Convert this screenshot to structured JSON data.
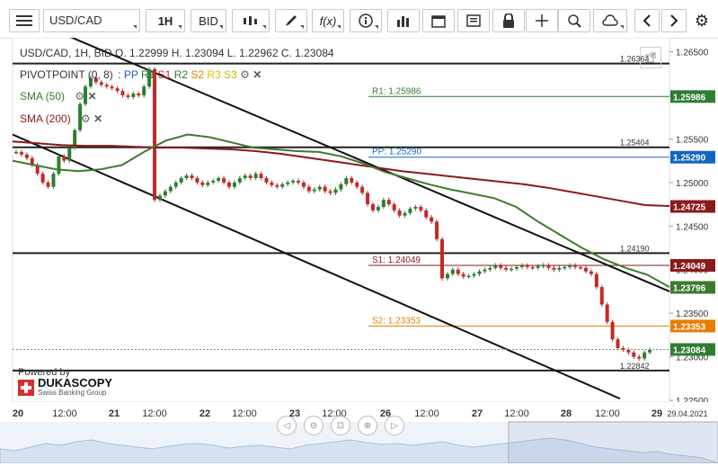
{
  "toolbar": {
    "symbol": "USD/CAD",
    "timeframe": "1H",
    "side": "BID",
    "fx_label": "f(x)"
  },
  "header": {
    "ohlc": "USD/CAD, 1H, BID   O. 1.22999 H. 1.23094 L. 1.22962 C. 1.23084",
    "pivot_label": "PIVOTPOINT (0, 8)",
    "pivot_levels": [
      "PP",
      "R1",
      "S1",
      "R2",
      "S2",
      "R3",
      "S3"
    ],
    "sma50": "SMA (50)",
    "sma200": "SMA (200)"
  },
  "branding": {
    "powered_by": "Powered by",
    "name": "DUKASCOPY",
    "tagline": "Swiss Banking Group"
  },
  "colors": {
    "candle_up": "#2e7d32",
    "candle_down": "#c62828",
    "sma50": "#3e7a2e",
    "sma200": "#8b1a1a",
    "pp": "#1565c0",
    "r1": "#2e7d32",
    "s1": "#8b1a1a",
    "s2": "#e67e00",
    "price": "#2e7d32"
  },
  "chart_data": {
    "type": "candlestick",
    "ylim": [
      1.2248,
      1.2666
    ],
    "y_ticks": [
      "1.26500",
      "1.26000",
      "1.25500",
      "1.25000",
      "1.24500",
      "1.24000",
      "1.23500",
      "1.23000",
      "1.22500"
    ],
    "x_labels": [
      "20",
      "12:00",
      "21",
      "12:00",
      "22",
      "12:00",
      "23",
      "12:00",
      "26",
      "12:00",
      "27",
      "12:00",
      "28",
      "12:00",
      "29",
      "29.04.2021"
    ],
    "pivot_lines": [
      {
        "name": "R1",
        "label": "R1: 1.25986",
        "value": 1.25986
      },
      {
        "name": "PP",
        "label": "PP: 1.25290",
        "value": 1.2529
      },
      {
        "name": "S1",
        "label": "S1: 1.24049",
        "value": 1.24049
      },
      {
        "name": "S2",
        "label": "S2: 1.23353",
        "value": 1.23353
      }
    ],
    "horizontal_levels": [
      {
        "label": "1.26364",
        "value": 1.26364
      },
      {
        "label": "1.25404",
        "value": 1.25404
      },
      {
        "label": "1.24190",
        "value": 1.2419
      },
      {
        "label": "1.22842",
        "value": 1.22842
      }
    ],
    "price_tags": [
      {
        "label": "1.25986",
        "value": 1.25986,
        "color": "#2e7d32"
      },
      {
        "label": "1.25290",
        "value": 1.2529,
        "color": "#1565c0"
      },
      {
        "label": "1.24725",
        "value": 1.24725,
        "color": "#8b1a1a"
      },
      {
        "label": "1.24049",
        "value": 1.24049,
        "color": "#8b1a1a"
      },
      {
        "label": "1.23796",
        "value": 1.23796,
        "color": "#3e7a2e"
      },
      {
        "label": "1.23353",
        "value": 1.23353,
        "color": "#e67e00"
      },
      {
        "label": "1.23084",
        "value": 1.23084,
        "color": "#2e7d32"
      }
    ],
    "close_path": [
      1.2535,
      1.2532,
      1.2528,
      1.252,
      1.251,
      1.25,
      1.2495,
      1.251,
      1.253,
      1.2525,
      1.254,
      1.256,
      1.259,
      1.261,
      1.262,
      1.2615,
      1.2612,
      1.261,
      1.2608,
      1.2605,
      1.26,
      1.2598,
      1.2602,
      1.26,
      1.261,
      1.263,
      1.248,
      1.2485,
      1.249,
      1.2495,
      1.25,
      1.2505,
      1.2508,
      1.2505,
      1.25,
      1.2497,
      1.25,
      1.2502,
      1.2505,
      1.25,
      1.2495,
      1.25,
      1.2505,
      1.2508,
      1.2505,
      1.251,
      1.2505,
      1.25,
      1.2497,
      1.2495,
      1.2498,
      1.25,
      1.2502,
      1.25,
      1.2495,
      1.249,
      1.2492,
      1.2495,
      1.249,
      1.2488,
      1.2492,
      1.2498,
      1.2505,
      1.25,
      1.2495,
      1.2488,
      1.2475,
      1.2468,
      1.2472,
      1.248,
      1.2475,
      1.2468,
      1.2462,
      1.2465,
      1.247,
      1.2472,
      1.2468,
      1.246,
      1.2455,
      1.2435,
      1.239,
      1.2395,
      1.24,
      1.2395,
      1.2392,
      1.2393,
      1.2395,
      1.2398,
      1.24,
      1.2402,
      1.2405,
      1.2402,
      1.24,
      1.2401,
      1.2403,
      1.2405,
      1.2403,
      1.2402,
      1.2404,
      1.2405,
      1.2402,
      1.24,
      1.2402,
      1.2403,
      1.2405,
      1.2403,
      1.2402,
      1.2398,
      1.2395,
      1.238,
      1.236,
      1.234,
      1.232,
      1.231,
      1.2308,
      1.2305,
      1.23,
      1.2298,
      1.2305,
      1.2308
    ],
    "sma50": [
      1.2525,
      1.252,
      1.2515,
      1.2513,
      1.2515,
      1.252,
      1.2535,
      1.2548,
      1.2555,
      1.2552,
      1.2546,
      1.254,
      1.2538,
      1.2536,
      1.2535,
      1.253,
      1.2522,
      1.2512,
      1.2505,
      1.2498,
      1.2492,
      1.2487,
      1.2482,
      1.2472,
      1.2455,
      1.244,
      1.2425,
      1.2412,
      1.2402,
      1.2394,
      1.238
    ],
    "sma200": [
      1.2547,
      1.2545,
      1.2543,
      1.2542,
      1.2542,
      1.2541,
      1.254,
      1.254,
      1.2539,
      1.2538,
      1.2536,
      1.2533,
      1.2529,
      1.2525,
      1.2521,
      1.2517,
      1.2513,
      1.251,
      1.2507,
      1.2504,
      1.2501,
      1.2498,
      1.2494,
      1.2489,
      1.2484,
      1.2479,
      1.2474,
      1.2473
    ]
  }
}
